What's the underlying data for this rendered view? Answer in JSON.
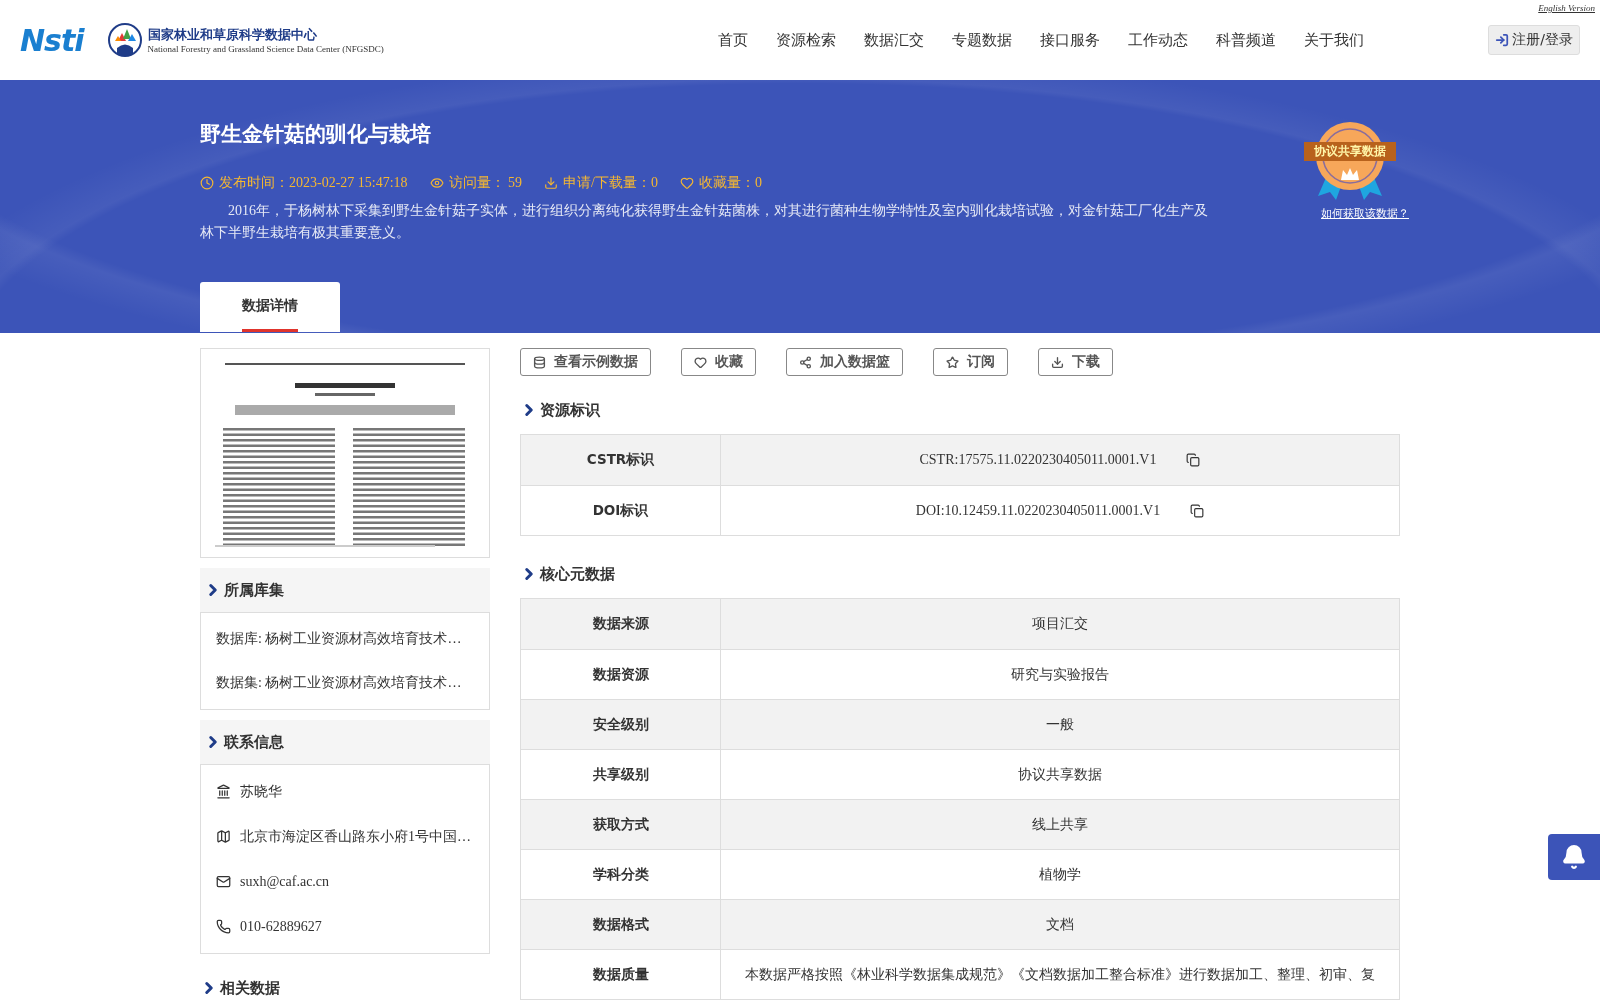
{
  "header": {
    "english_link": "English Version",
    "logo_text": "Nsti",
    "center_name": "国家林业和草原科学数据中心",
    "center_name_en": "National Forestry and Grassland Science Data Center (NFGSDC)",
    "nav": [
      {
        "label": "首页"
      },
      {
        "label": "资源检索"
      },
      {
        "label": "数据汇交"
      },
      {
        "label": "专题数据"
      },
      {
        "label": "接口服务"
      },
      {
        "label": "工作动态"
      },
      {
        "label": "科普频道"
      },
      {
        "label": "关于我们"
      }
    ],
    "login_button": "注册/登录"
  },
  "banner": {
    "title": "野生金针菇的驯化与栽培",
    "meta": [
      {
        "kind": "clock",
        "text": "发布时间：2023-02-27 15:47:18"
      },
      {
        "kind": "eye",
        "text": "访问量： 59"
      },
      {
        "kind": "download",
        "text": "申请/下载量：0"
      },
      {
        "kind": "heart",
        "text": "收藏量：0"
      }
    ],
    "description": "2016年，于杨树林下采集到野生金针菇子实体，进行组织分离纯化获得野生金针菇菌株，对其进行菌种生物学特性及室内驯化栽培试验，对金针菇工厂化生产及林下半野生栽培有极其重要意义。",
    "badge": "协议共享数据",
    "badge_link": "如何获取该数据？",
    "tabs": [
      {
        "label": "数据详情",
        "selected": true
      }
    ]
  },
  "sidebar": {
    "collections": {
      "title": "所属库集",
      "items": [
        "数据库: 杨树工业资源材高效培育技术…",
        "数据集: 杨树工业资源材高效培育技术…"
      ]
    },
    "contact": {
      "title": "联系信息",
      "items": [
        {
          "kind": "institution",
          "text": "苏晓华"
        },
        {
          "kind": "address",
          "text": "北京市海淀区香山路东小府1号中国…"
        },
        {
          "kind": "email",
          "text": "suxh@caf.ac.cn"
        },
        {
          "kind": "phone",
          "text": "010-62889627"
        }
      ]
    },
    "related": {
      "title": "相关数据"
    }
  },
  "actions": [
    {
      "kind": "database",
      "label": "查看示例数据"
    },
    {
      "kind": "heart",
      "label": "收藏"
    },
    {
      "kind": "share",
      "label": "加入数据篮"
    },
    {
      "kind": "star",
      "label": "订阅"
    },
    {
      "kind": "download",
      "label": "下载"
    }
  ],
  "identifiers": {
    "title": "资源标识",
    "rows": [
      {
        "label": "CSTR标识",
        "value": "CSTR:17575.11.0220230405011.0001.V1"
      },
      {
        "label": "DOI标识",
        "value": "DOI:10.12459.11.0220230405011.0001.V1"
      }
    ]
  },
  "core_metadata": {
    "title": "核心元数据",
    "rows": [
      {
        "label": "数据来源",
        "value": "项目汇交"
      },
      {
        "label": "数据资源",
        "value": "研究与实验报告"
      },
      {
        "label": "安全级别",
        "value": "一般"
      },
      {
        "label": "共享级别",
        "value": "协议共享数据"
      },
      {
        "label": "获取方式",
        "value": "线上共享"
      },
      {
        "label": "学科分类",
        "value": "植物学"
      },
      {
        "label": "数据格式",
        "value": "文档"
      },
      {
        "label": "数据质量",
        "value": "本数据严格按照《林业科学数据集成规范》《文档数据加工整合标准》进行数据加工、整理、初审、复"
      }
    ]
  }
}
